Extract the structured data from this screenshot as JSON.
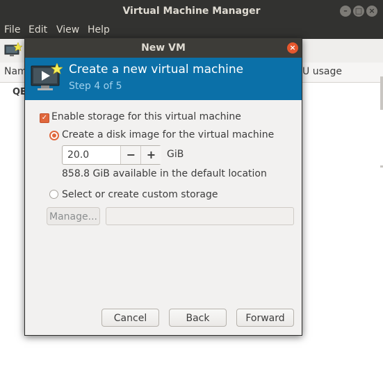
{
  "main_window": {
    "title": "Virtual Machine Manager",
    "menu": [
      "File",
      "Edit",
      "View",
      "Help"
    ],
    "list_header_left": "Nam",
    "list_header_right": "U usage",
    "row_left": "QE"
  },
  "dialog": {
    "title": "New VM",
    "header_title": "Create a new virtual machine",
    "header_step": "Step 4 of 5",
    "enable_storage_label": "Enable storage for this virtual machine",
    "enable_storage_checked": true,
    "disk_image_label": "Create a disk image for the virtual machine",
    "disk_size_value": "20.0",
    "disk_unit": "GiB",
    "available_text": "858.8 GiB available in the default location",
    "custom_storage_label": "Select or create custom storage",
    "manage_button": "Manage...",
    "custom_path_value": "",
    "buttons": {
      "cancel": "Cancel",
      "back": "Back",
      "forward": "Forward"
    }
  },
  "icons": [
    "monitor-play-icon",
    "new-star-icon",
    "close-icon",
    "minimize-icon",
    "maximize-icon",
    "minus-icon",
    "plus-icon"
  ],
  "colors": {
    "accent": "#e0673c",
    "header_band": "#0b70a8",
    "titlebar": "#323230"
  }
}
